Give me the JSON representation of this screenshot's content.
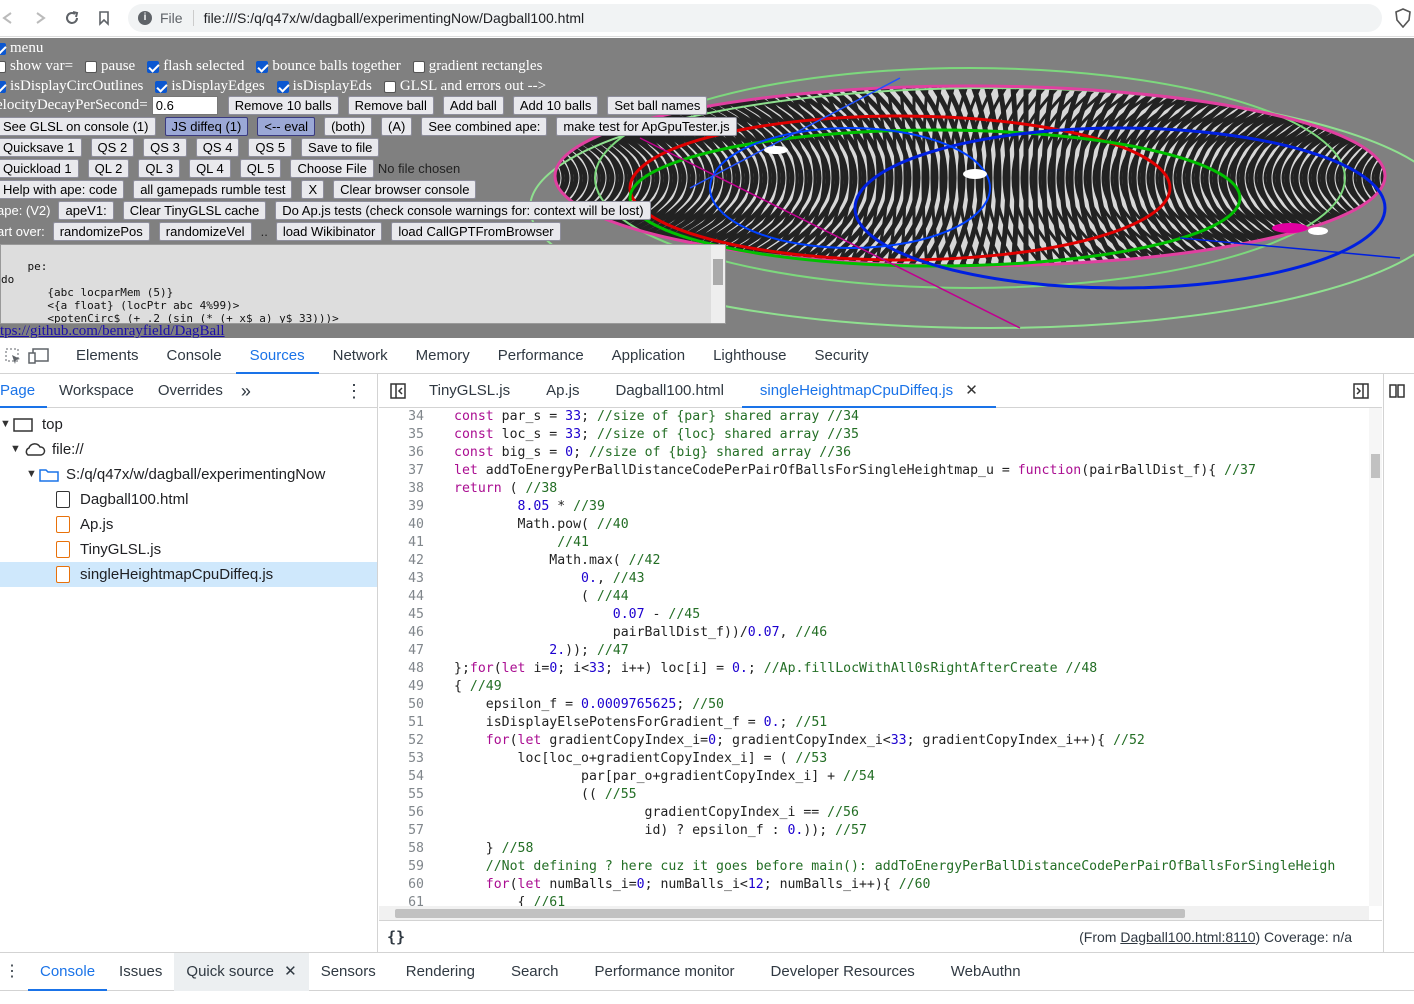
{
  "browser": {
    "file_label": "File",
    "url": "file:///S:/q/q47x/w/dagball/experimentingNow/Dagball100.html"
  },
  "page": {
    "menu_label": "menu",
    "row1": {
      "show_var": "show var=",
      "pause": "pause",
      "flash_selected": "flash selected",
      "bounce": "bounce balls together",
      "gradient": "gradient rectangles"
    },
    "row2": {
      "circ": "isDisplayCircOutlines",
      "edges": "isDisplayEdges",
      "eds": "isDisplayEds",
      "glsl": "GLSL and errors out -->"
    },
    "row3": {
      "velocity_label": "elocityDecayPerSecond=",
      "velocity_value": "0.6",
      "buttons": [
        "Remove 10 balls",
        "Remove ball",
        "Add ball",
        "Add 10 balls",
        "Set ball names"
      ]
    },
    "row4": {
      "buttons": [
        "See GLSL on console (1)",
        "JS diffeq (1)",
        "<-- eval",
        "(both)",
        "(A)",
        "See combined ape:",
        "make test for ApGpuTester.js"
      ]
    },
    "row5": {
      "buttons": [
        "Quicksave 1",
        "QS 2",
        "QS 3",
        "QS 4",
        "QS 5",
        "Save to file"
      ]
    },
    "row6": {
      "buttons": [
        "Quickload 1",
        "QL 2",
        "QL 3",
        "QL 4",
        "QL 5",
        "Choose File"
      ],
      "no_file": "No file chosen"
    },
    "row7": {
      "buttons": [
        "Help with ape: code",
        "all gamepads rumble test",
        "X",
        "Clear browser console"
      ]
    },
    "row8": {
      "label": "ape: (V2)",
      "buttons": [
        "apeV1:",
        "Clear TinyGLSL cache",
        "Do Ap.js tests (check console warnings for: context will be lost)"
      ]
    },
    "row9": {
      "label": "art over:",
      "buttons": [
        "randomizePos",
        "randomizeVel",
        "load Wikibinator",
        "load CallGPTFromBrowser"
      ],
      "dots": ".."
    },
    "textarea": "pe:\ndo\n       {abc locparMem (5)}\n       <{a float} (locPtr abc 4%99)>\n       <potenCirc$ (+ .2 (sin (* (+ x$ a) y$ 33)))>",
    "github": "tps://github.com/benrayfield/DagBall"
  },
  "devtools": {
    "tabs": [
      "Elements",
      "Console",
      "Sources",
      "Network",
      "Memory",
      "Performance",
      "Application",
      "Lighthouse",
      "Security"
    ],
    "active_tab": "Sources",
    "nav_tabs": [
      "Page",
      "Workspace",
      "Overrides"
    ],
    "tree": [
      {
        "label": "top",
        "depth": 0,
        "type": "frame"
      },
      {
        "label": "file://",
        "depth": 1,
        "type": "cloud"
      },
      {
        "label": "S:/q/q47x/w/dagball/experimentingNow",
        "depth": 2,
        "type": "folder"
      },
      {
        "label": "Dagball100.html",
        "depth": 3,
        "type": "file"
      },
      {
        "label": "Ap.js",
        "depth": 3,
        "type": "js"
      },
      {
        "label": "TinyGLSL.js",
        "depth": 3,
        "type": "js"
      },
      {
        "label": "singleHeightmapCpuDiffeq.js",
        "depth": 3,
        "type": "js",
        "selected": true
      }
    ],
    "editor_tabs": [
      "TinyGLSL.js",
      "Ap.js",
      "Dagball100.html",
      "singleHeightmapCpuDiffeq.js"
    ],
    "code_lines": [
      {
        "n": "34",
        "html": "<span class='kw'>const</span> par_s = <span class='num'>33</span>; <span class='cm'>//size of {par} shared array //34</span>"
      },
      {
        "n": "35",
        "html": "<span class='kw'>const</span> loc_s = <span class='num'>33</span>; <span class='cm'>//size of {loc} shared array //35</span>"
      },
      {
        "n": "36",
        "html": "<span class='kw'>const</span> big_s = <span class='num'>0</span>; <span class='cm'>//size of {big} shared array //36</span>"
      },
      {
        "n": "37",
        "html": "<span class='kw'>let</span> addToEnergyPerBallDistanceCodePerPairOfBallsForSingleHeightmap_u = <span class='kw'>function</span>(pairBallDist_f){ <span class='cm'>//37</span>"
      },
      {
        "n": "38",
        "html": "<span class='kw'>return</span> ( <span class='cm'>//38</span>"
      },
      {
        "n": "39",
        "html": "        <span class='num'>8.05</span> * <span class='cm'>//39</span>"
      },
      {
        "n": "40",
        "html": "        Math.pow( <span class='cm'>//40</span>"
      },
      {
        "n": "41",
        "html": "             <span class='cm'>//41</span>"
      },
      {
        "n": "42",
        "html": "            Math.max( <span class='cm'>//42</span>"
      },
      {
        "n": "43",
        "html": "                <span class='num'>0.</span>, <span class='cm'>//43</span>"
      },
      {
        "n": "44",
        "html": "                ( <span class='cm'>//44</span>"
      },
      {
        "n": "45",
        "html": "                    <span class='num'>0.07</span> - <span class='cm'>//45</span>"
      },
      {
        "n": "46",
        "html": "                    pairBallDist_f))/<span class='num'>0.07</span>, <span class='cm'>//46</span>"
      },
      {
        "n": "47",
        "html": "            <span class='num'>2.</span>)); <span class='cm'>//47</span>"
      },
      {
        "n": "48",
        "html": "};<span class='kw'>for</span>(<span class='kw'>let</span> i=<span class='num'>0</span>; i&lt;<span class='num'>33</span>; i++) loc[i] = <span class='num'>0.</span>; <span class='cm'>//Ap.fillLocWithAll0sRightAfterCreate //48</span>"
      },
      {
        "n": "49",
        "html": "{ <span class='cm'>//49</span>"
      },
      {
        "n": "50",
        "html": "    epsilon_f = <span class='num'>0.0009765625</span>; <span class='cm'>//50</span>"
      },
      {
        "n": "51",
        "html": "    isDisplayElsePotensForGradient_f = <span class='num'>0.</span>; <span class='cm'>//51</span>"
      },
      {
        "n": "52",
        "html": "    <span class='kw'>for</span>(<span class='kw'>let</span> gradientCopyIndex_i=<span class='num'>0</span>; gradientCopyIndex_i&lt;<span class='num'>33</span>; gradientCopyIndex_i++){ <span class='cm'>//52</span>"
      },
      {
        "n": "53",
        "html": "        loc[loc_o+gradientCopyIndex_i] = ( <span class='cm'>//53</span>"
      },
      {
        "n": "54",
        "html": "                par[par_o+gradientCopyIndex_i] + <span class='cm'>//54</span>"
      },
      {
        "n": "55",
        "html": "                (( <span class='cm'>//55</span>"
      },
      {
        "n": "56",
        "html": "                        gradientCopyIndex_i == <span class='cm'>//56</span>"
      },
      {
        "n": "57",
        "html": "                        id) ? epsilon_f : <span class='num'>0.</span>)); <span class='cm'>//57</span>"
      },
      {
        "n": "58",
        "html": "    } <span class='cm'>//58</span>"
      },
      {
        "n": "59",
        "html": "    <span class='cm'>//Not defining ? here cuz it goes before main(): addToEnergyPerBallDistanceCodePerPairOfBallsForSingleHeigh</span>"
      },
      {
        "n": "60",
        "html": "    <span class='kw'>for</span>(<span class='kw'>let</span> numBalls_i=<span class='num'>0</span>; numBalls_i&lt;<span class='num'>12</span>; numBalls_i++){ <span class='cm'>//60</span>"
      },
      {
        "n": "61",
        "html": "        { <span class='cm'>//61</span>"
      }
    ],
    "status_from": "(From",
    "status_link": "Dagball100.html:8110",
    "status_coverage": ") Coverage: n/a",
    "format_icon": "{}",
    "drawer_tabs": [
      "Console",
      "Issues",
      "Quick source",
      "Sensors",
      "Rendering",
      "Search",
      "Performance monitor",
      "Developer Resources",
      "WebAuthn"
    ]
  }
}
